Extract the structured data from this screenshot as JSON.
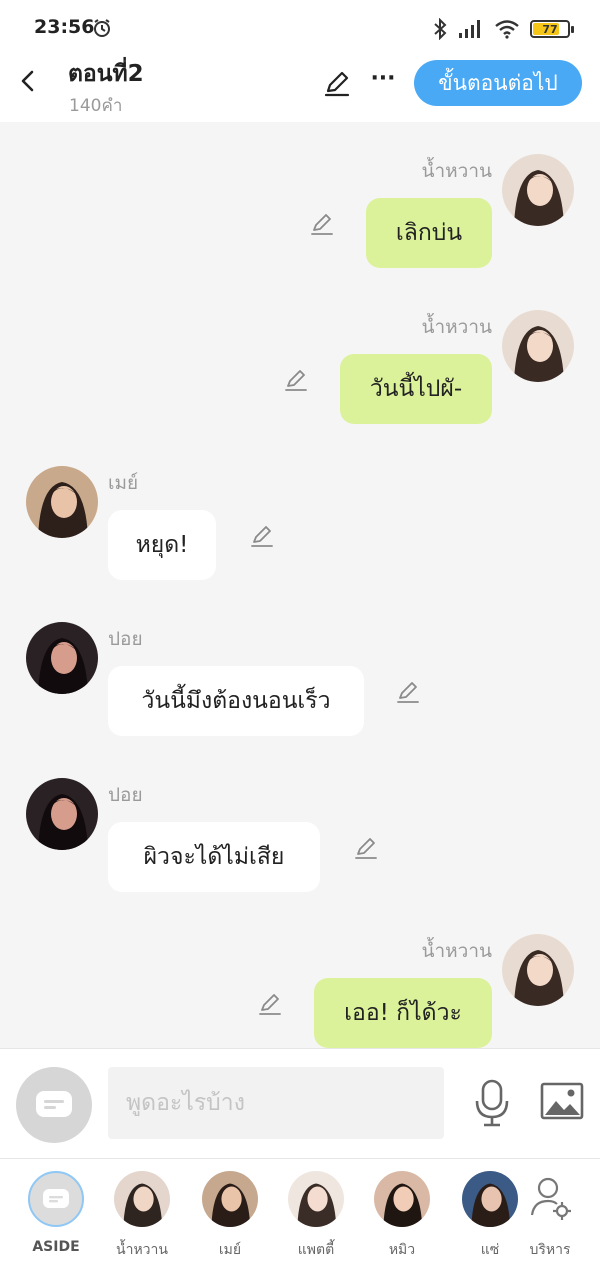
{
  "status_bar": {
    "time": "23:56",
    "battery": "77",
    "icons": [
      "alarm-icon",
      "bluetooth-icon",
      "signal-icon",
      "wifi-icon",
      "battery-icon"
    ]
  },
  "header": {
    "title": "ตอนที่2",
    "subtitle": "140คำ",
    "more_label": "···",
    "next_label": "ขั้นตอนต่อไป"
  },
  "messages": [
    {
      "side": "right",
      "name": "น้ำหวาน",
      "text": "เลิกบ่น"
    },
    {
      "side": "right",
      "name": "น้ำหวาน",
      "text": "วันนี้ไปผั-"
    },
    {
      "side": "left",
      "name": "เมย์",
      "text": "หยุด!"
    },
    {
      "side": "left",
      "name": "ปอย",
      "text": "วันนี้มึงต้องนอนเร็ว"
    },
    {
      "side": "left",
      "name": "ปอย",
      "text": "ผิวจะได้ไม่เสีย"
    },
    {
      "side": "right",
      "name": "น้ำหวาน",
      "text": "เออ! ก็ได้วะ"
    }
  ],
  "composer": {
    "placeholder": "พูดอะไรบ้าง"
  },
  "characters": [
    {
      "label": "ASIDE"
    },
    {
      "label": "น้ำหวาน"
    },
    {
      "label": "เมย์"
    },
    {
      "label": "แพตตี้"
    },
    {
      "label": "หมิว"
    },
    {
      "label": "แซ่"
    },
    {
      "label": "บริหาร"
    }
  ],
  "colors": {
    "accent": "#4aa9f5",
    "bubble_self": "#dcf29a",
    "bubble_other": "#ffffff",
    "background": "#f5f5f5"
  }
}
